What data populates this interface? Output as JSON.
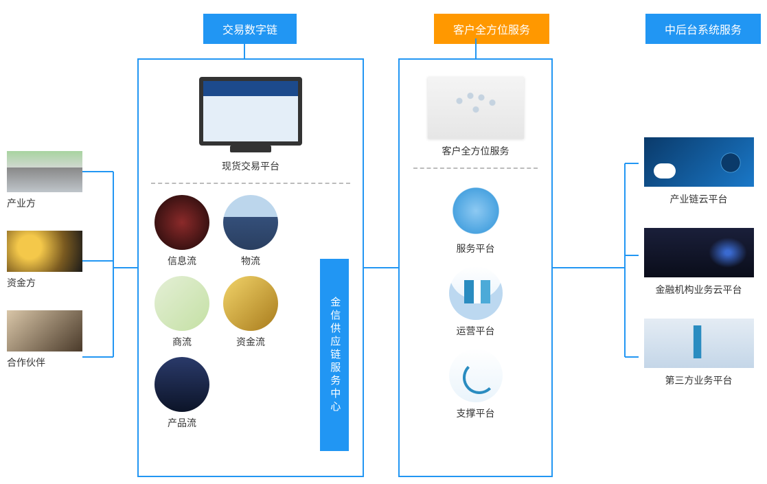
{
  "headers": {
    "trade": "交易数字链",
    "customer": "客户全方位服务",
    "backoffice": "中后台系统服务"
  },
  "left": [
    {
      "label": "产业方"
    },
    {
      "label": "资金方"
    },
    {
      "label": "合作伙伴"
    }
  ],
  "trade_box": {
    "top_caption": "现货交易平台",
    "vbar": "金信供应链服务中心",
    "flows": [
      {
        "label": "信息流"
      },
      {
        "label": "物流"
      },
      {
        "label": "商流"
      },
      {
        "label": "资金流"
      },
      {
        "label": "产品流"
      }
    ]
  },
  "customer_box": {
    "top_caption": "客户全方位服务",
    "platforms": [
      {
        "label": "服务平台"
      },
      {
        "label": "运营平台"
      },
      {
        "label": "支撑平台"
      }
    ]
  },
  "right": [
    {
      "label": "产业链云平台"
    },
    {
      "label": "金融机构业务云平台"
    },
    {
      "label": "第三方业务平台"
    }
  ]
}
